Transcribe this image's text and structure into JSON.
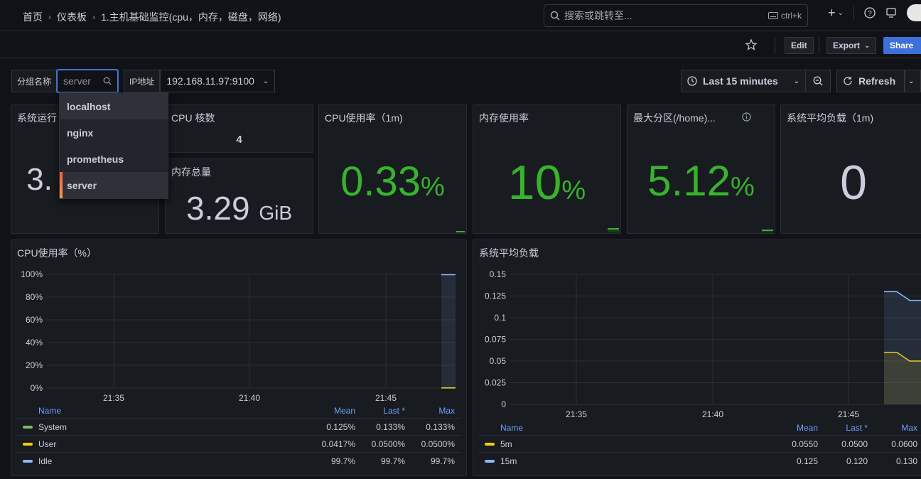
{
  "breadcrumb": {
    "home": "首页",
    "dashboards": "仪表板",
    "current": "1.主机基础监控(cpu，内存，磁盘，网络)"
  },
  "search": {
    "placeholder": "搜索或跳转至...",
    "shortcut": "ctrl+k"
  },
  "toolbar": {
    "edit": "Edit",
    "export": "Export",
    "share": "Share"
  },
  "variables": {
    "group_label": "分组名称",
    "group_value": "server",
    "ip_label": "IP地址",
    "ip_value": "192.168.11.97:9100",
    "group_options": [
      "localhost",
      "nginx",
      "prometheus",
      "server"
    ],
    "selected_option": "server"
  },
  "timepicker": {
    "range": "Last 15 minutes",
    "refresh": "Refresh"
  },
  "panels": {
    "uptime": {
      "title": "系统运行",
      "value": "3."
    },
    "cpu_cores": {
      "title": "CPU 核数",
      "value": "4"
    },
    "mem_total": {
      "title": "内存总量",
      "value": "3.29",
      "unit": "GiB"
    },
    "cpu_usage": {
      "title": "CPU使用率（1m)",
      "value": "0.33",
      "unit": "%"
    },
    "mem_usage": {
      "title": "内存使用率",
      "value": "10",
      "unit": "%"
    },
    "disk": {
      "title": "最大分区(/home)...",
      "value": "5.12",
      "unit": "%"
    },
    "load": {
      "title": "系统平均负载（1m)",
      "value": "0"
    }
  },
  "colors": {
    "green": "#37b32d",
    "yellow": "#f2cc0c",
    "blue": "#8ab8ff",
    "accent": "#3d71d9"
  },
  "chart_data": [
    {
      "type": "line",
      "title": "CPU使用率（%）",
      "x_ticks": [
        "21:35",
        "21:40",
        "21:45"
      ],
      "y_ticks": [
        "0%",
        "20%",
        "40%",
        "60%",
        "80%",
        "100%"
      ],
      "ylim": [
        0,
        100
      ],
      "series": [
        {
          "name": "System",
          "color": "#73bf69",
          "values": [
            0.125,
            0.133
          ],
          "mean": "0.125%",
          "last": "0.133%",
          "max": "0.133%"
        },
        {
          "name": "User",
          "color": "#f2cc0c",
          "values": [
            0.0417,
            0.05
          ],
          "mean": "0.0417%",
          "last": "0.0500%",
          "max": "0.0500%"
        },
        {
          "name": "Idle",
          "color": "#8ab8ff",
          "values": [
            99.7,
            99.7
          ],
          "mean": "99.7%",
          "last": "99.7%",
          "max": "99.7%"
        }
      ],
      "legend_headers": {
        "name": "Name",
        "mean": "Mean",
        "last": "Last *",
        "max": "Max"
      }
    },
    {
      "type": "line",
      "title": "系统平均负载",
      "x_ticks": [
        "21:35",
        "21:40",
        "21:45"
      ],
      "y_ticks": [
        "0",
        "0.025",
        "0.05",
        "0.075",
        "0.1",
        "0.125",
        "0.15"
      ],
      "ylim": [
        0,
        0.15
      ],
      "series": [
        {
          "name": "5m",
          "color": "#f2cc0c",
          "values": [
            0.06,
            0.06,
            0.05,
            0.05
          ],
          "mean": "0.0550",
          "last": "0.0500",
          "max": "0.0600"
        },
        {
          "name": "15m",
          "color": "#8ab8ff",
          "values": [
            0.13,
            0.13,
            0.12,
            0.12
          ],
          "mean": "0.125",
          "last": "0.120",
          "max": "0.130"
        }
      ],
      "legend_headers": {
        "name": "Name",
        "mean": "Mean",
        "last": "Last *",
        "max": "Max"
      }
    }
  ]
}
